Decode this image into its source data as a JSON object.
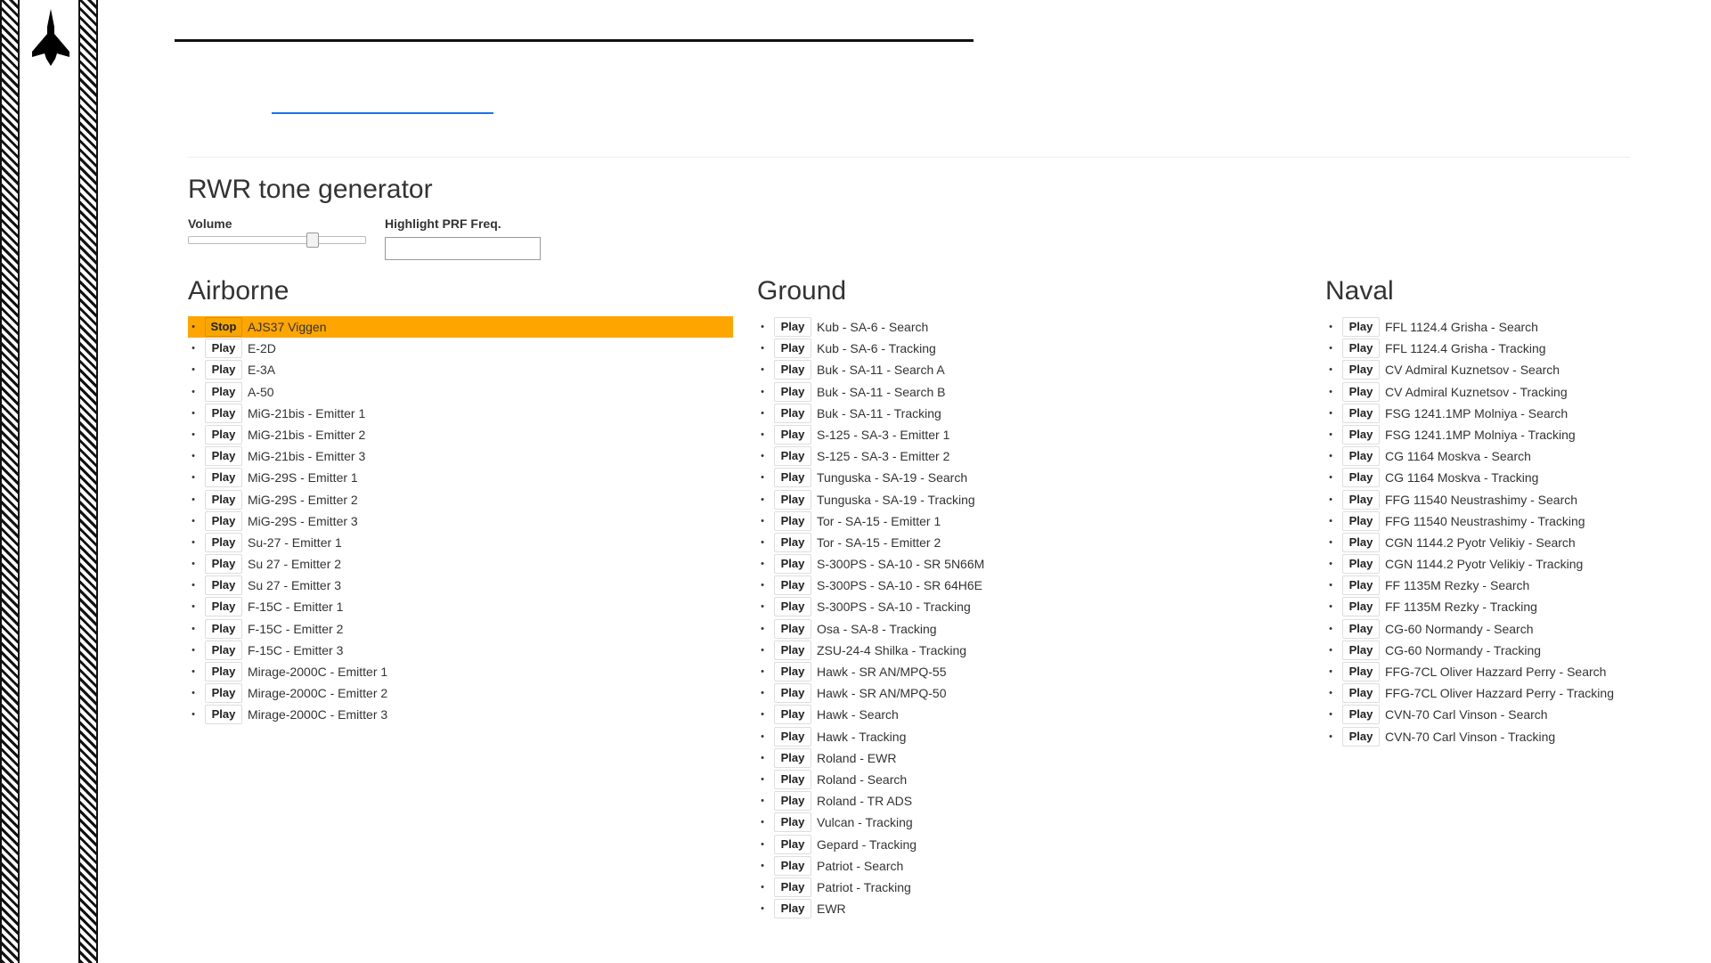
{
  "page": {
    "title": "RWR tone generator"
  },
  "controls": {
    "volume_label": "Volume",
    "volume_value": 0.72,
    "prf_label": "Highlight PRF Freq.",
    "prf_value": ""
  },
  "colors": {
    "active_row": "#ffa500",
    "link_rule": "#1a73e8"
  },
  "sections": [
    {
      "title": "Airborne",
      "items": [
        {
          "button": "Stop",
          "label": "AJS37 Viggen",
          "active": true
        },
        {
          "button": "Play",
          "label": "E-2D"
        },
        {
          "button": "Play",
          "label": "E-3A"
        },
        {
          "button": "Play",
          "label": "A-50"
        },
        {
          "button": "Play",
          "label": "MiG-21bis - Emitter 1"
        },
        {
          "button": "Play",
          "label": "MiG-21bis - Emitter 2"
        },
        {
          "button": "Play",
          "label": "MiG-21bis - Emitter 3"
        },
        {
          "button": "Play",
          "label": "MiG-29S - Emitter 1"
        },
        {
          "button": "Play",
          "label": "MiG-29S - Emitter 2"
        },
        {
          "button": "Play",
          "label": "MiG-29S - Emitter 3"
        },
        {
          "button": "Play",
          "label": "Su-27 - Emitter 1"
        },
        {
          "button": "Play",
          "label": "Su 27 - Emitter 2"
        },
        {
          "button": "Play",
          "label": "Su 27 - Emitter 3"
        },
        {
          "button": "Play",
          "label": "F-15C - Emitter 1"
        },
        {
          "button": "Play",
          "label": "F-15C - Emitter 2"
        },
        {
          "button": "Play",
          "label": "F-15C - Emitter 3"
        },
        {
          "button": "Play",
          "label": "Mirage-2000C - Emitter 1"
        },
        {
          "button": "Play",
          "label": "Mirage-2000C - Emitter 2"
        },
        {
          "button": "Play",
          "label": "Mirage-2000C - Emitter 3"
        }
      ]
    },
    {
      "title": "Ground",
      "items": [
        {
          "button": "Play",
          "label": "Kub - SA-6 - Search"
        },
        {
          "button": "Play",
          "label": "Kub - SA-6 - Tracking"
        },
        {
          "button": "Play",
          "label": "Buk - SA-11 - Search A"
        },
        {
          "button": "Play",
          "label": "Buk - SA-11 - Search B"
        },
        {
          "button": "Play",
          "label": "Buk - SA-11 - Tracking"
        },
        {
          "button": "Play",
          "label": "S-125 - SA-3 - Emitter 1"
        },
        {
          "button": "Play",
          "label": "S-125 - SA-3 - Emitter 2"
        },
        {
          "button": "Play",
          "label": "Tunguska - SA-19 - Search"
        },
        {
          "button": "Play",
          "label": "Tunguska - SA-19 - Tracking"
        },
        {
          "button": "Play",
          "label": "Tor - SA-15 - Emitter 1"
        },
        {
          "button": "Play",
          "label": "Tor - SA-15 - Emitter 2"
        },
        {
          "button": "Play",
          "label": "S-300PS - SA-10 - SR 5N66M"
        },
        {
          "button": "Play",
          "label": "S-300PS - SA-10 - SR 64H6E"
        },
        {
          "button": "Play",
          "label": "S-300PS - SA-10 - Tracking"
        },
        {
          "button": "Play",
          "label": "Osa - SA-8 - Tracking"
        },
        {
          "button": "Play",
          "label": "ZSU-24-4 Shilka - Tracking"
        },
        {
          "button": "Play",
          "label": "Hawk - SR AN/MPQ-55"
        },
        {
          "button": "Play",
          "label": "Hawk - SR AN/MPQ-50"
        },
        {
          "button": "Play",
          "label": "Hawk - Search"
        },
        {
          "button": "Play",
          "label": "Hawk - Tracking"
        },
        {
          "button": "Play",
          "label": "Roland - EWR"
        },
        {
          "button": "Play",
          "label": "Roland - Search"
        },
        {
          "button": "Play",
          "label": "Roland - TR ADS"
        },
        {
          "button": "Play",
          "label": "Vulcan - Tracking"
        },
        {
          "button": "Play",
          "label": "Gepard - Tracking"
        },
        {
          "button": "Play",
          "label": "Patriot - Search"
        },
        {
          "button": "Play",
          "label": "Patriot - Tracking"
        },
        {
          "button": "Play",
          "label": "EWR"
        }
      ]
    },
    {
      "title": "Naval",
      "items": [
        {
          "button": "Play",
          "label": "FFL 1124.4 Grisha - Search"
        },
        {
          "button": "Play",
          "label": "FFL 1124.4 Grisha - Tracking"
        },
        {
          "button": "Play",
          "label": "CV Admiral Kuznetsov - Search"
        },
        {
          "button": "Play",
          "label": "CV Admiral Kuznetsov - Tracking"
        },
        {
          "button": "Play",
          "label": "FSG 1241.1MP Molniya - Search"
        },
        {
          "button": "Play",
          "label": "FSG 1241.1MP Molniya - Tracking"
        },
        {
          "button": "Play",
          "label": "CG 1164 Moskva - Search"
        },
        {
          "button": "Play",
          "label": "CG 1164 Moskva - Tracking"
        },
        {
          "button": "Play",
          "label": "FFG 11540 Neustrashimy - Search"
        },
        {
          "button": "Play",
          "label": "FFG 11540 Neustrashimy - Tracking"
        },
        {
          "button": "Play",
          "label": "CGN 1144.2 Pyotr Velikiy - Search"
        },
        {
          "button": "Play",
          "label": "CGN 1144.2 Pyotr Velikiy - Tracking"
        },
        {
          "button": "Play",
          "label": "FF 1135M Rezky - Search"
        },
        {
          "button": "Play",
          "label": "FF 1135M Rezky - Tracking"
        },
        {
          "button": "Play",
          "label": "CG-60 Normandy - Search"
        },
        {
          "button": "Play",
          "label": "CG-60 Normandy - Tracking"
        },
        {
          "button": "Play",
          "label": "FFG-7CL Oliver Hazzard Perry - Search"
        },
        {
          "button": "Play",
          "label": "FFG-7CL Oliver Hazzard Perry - Tracking"
        },
        {
          "button": "Play",
          "label": "CVN-70 Carl Vinson - Search"
        },
        {
          "button": "Play",
          "label": "CVN-70 Carl Vinson - Tracking"
        }
      ]
    }
  ]
}
